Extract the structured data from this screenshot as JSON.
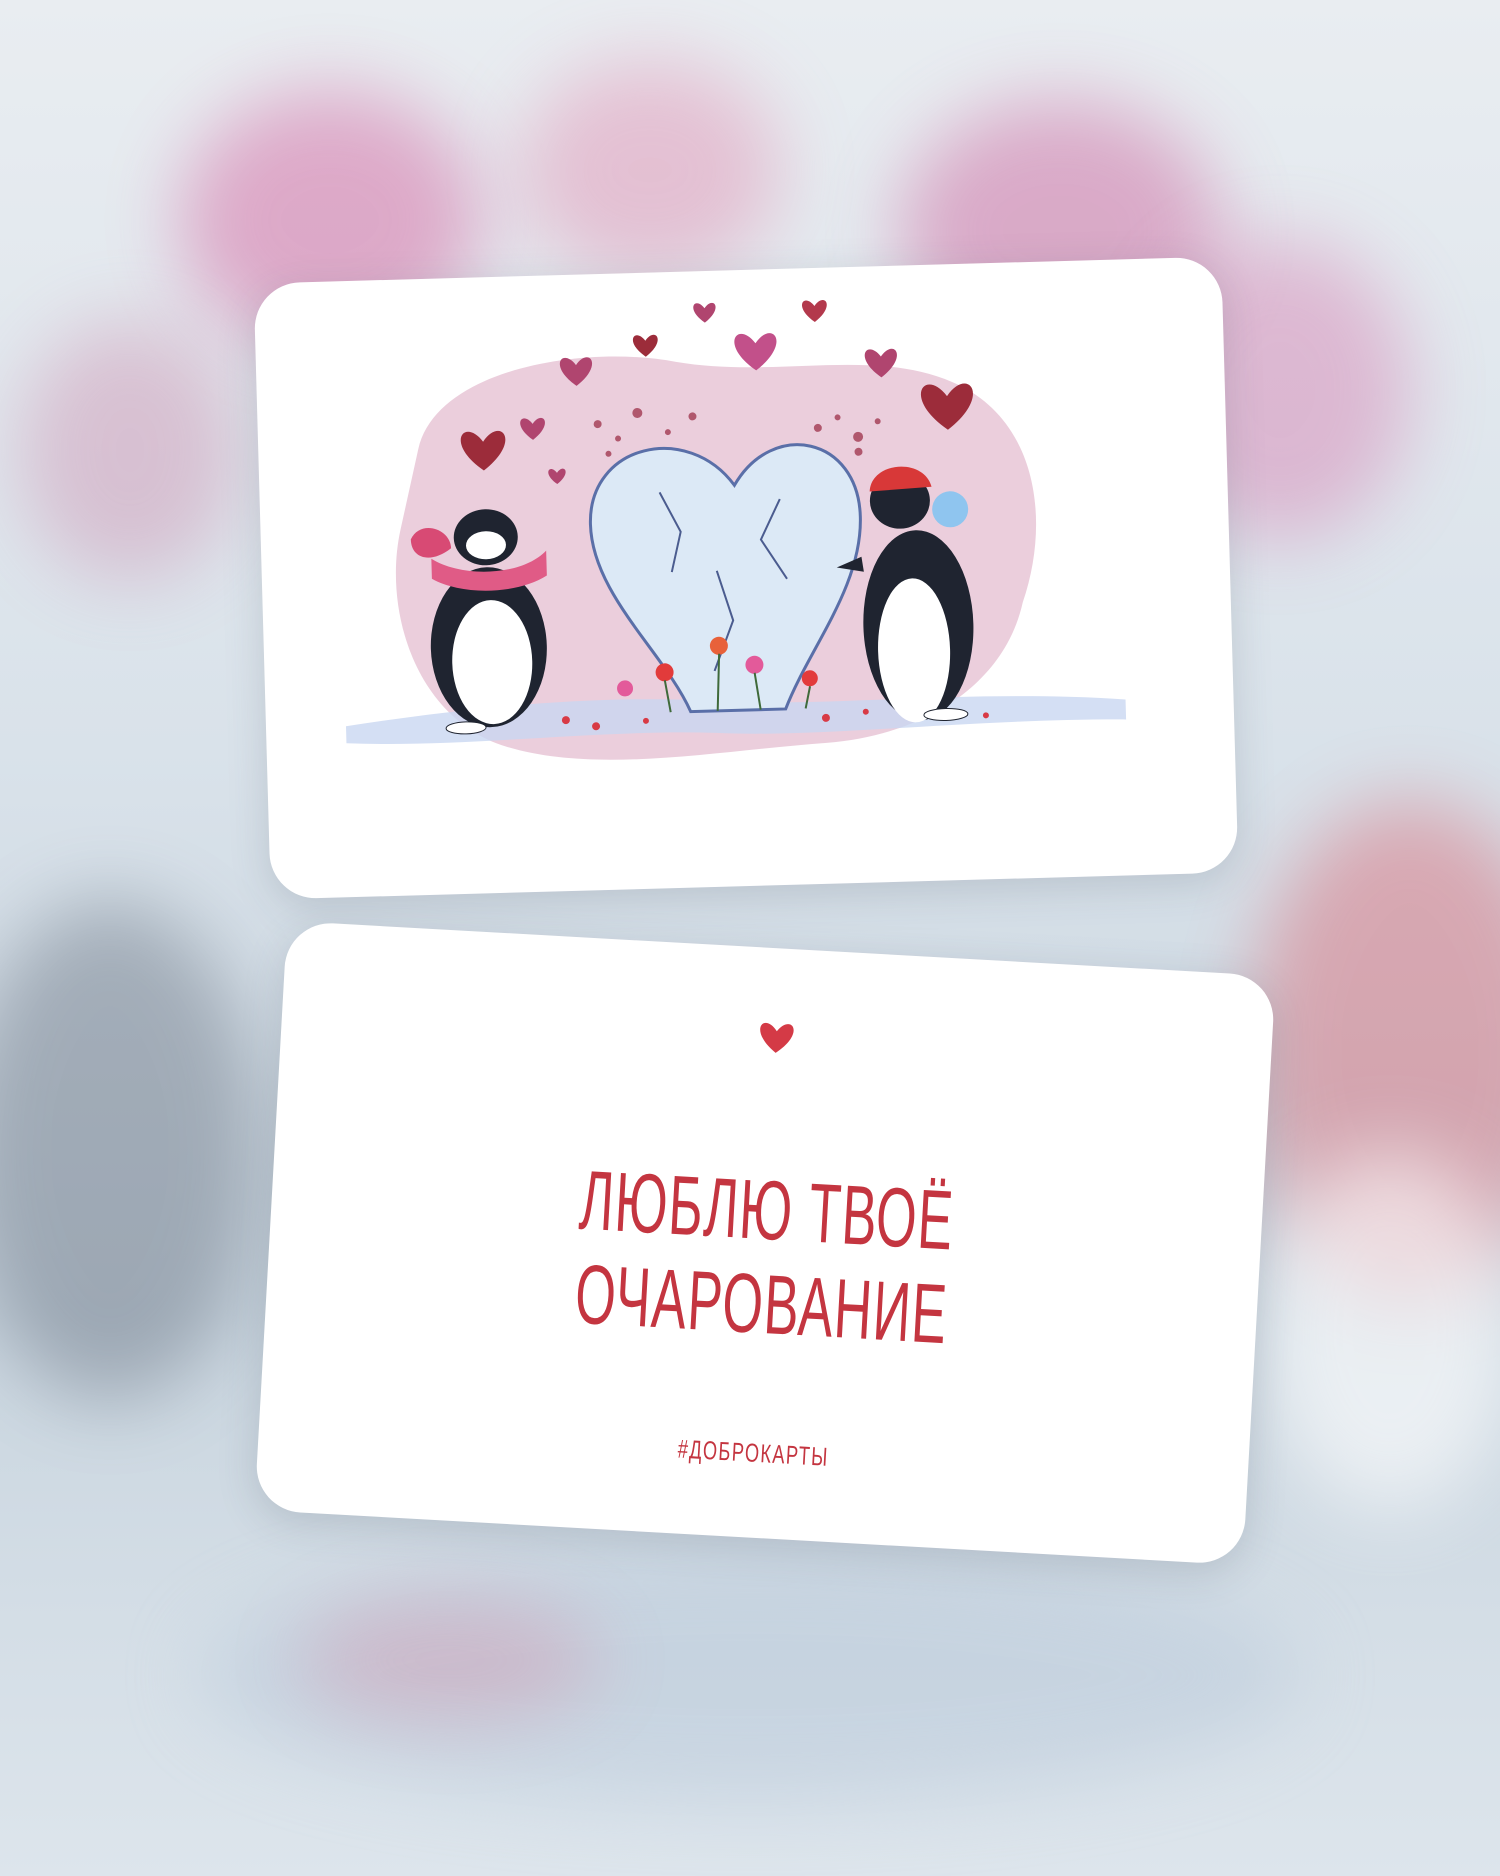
{
  "back_card": {
    "title_line1": "ЛЮБЛЮ ТВОЁ",
    "title_line2": "ОЧАРОВАНИЕ",
    "hashtag": "#ДОБРОКАРТЫ",
    "heart_icon": "heart-icon"
  },
  "front_card": {
    "illustration": "two-penguins-with-ice-heart"
  },
  "colors": {
    "accent_red": "#c43540",
    "heart_pink": "#b0456f",
    "heart_dark": "#9c2c3a",
    "ice_blue": "#dce9f6",
    "blush_pink": "#e8c6d6"
  }
}
